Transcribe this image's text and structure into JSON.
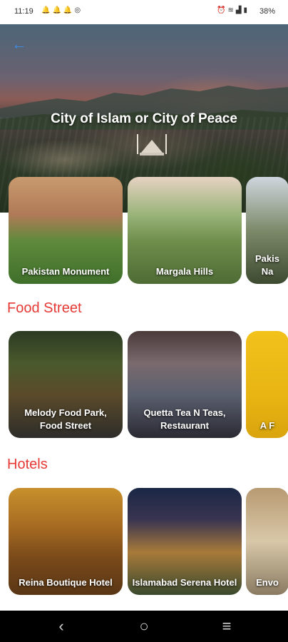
{
  "status_bar": {
    "time": "11:19",
    "left_icons": [
      "notification-bell-icon",
      "notification-bell-icon",
      "notification-bell-icon",
      "instagram-icon"
    ],
    "right_icons": [
      "alarm-icon",
      "wifi-icon",
      "signal-icon",
      "battery-icon"
    ],
    "battery": "38%"
  },
  "hero": {
    "title": "City of Islam or City of Peace",
    "back_icon": "back-arrow-icon"
  },
  "attractions": {
    "items": [
      {
        "label": "Pakistan Monument"
      },
      {
        "label": "Margala Hills"
      },
      {
        "label": "Pakis Na"
      }
    ]
  },
  "food_street": {
    "title": "Food Street",
    "items": [
      {
        "label": "Melody Food Park, Food Street"
      },
      {
        "label": "Quetta Tea N Teas, Restaurant"
      },
      {
        "label": "A F"
      }
    ]
  },
  "hotels": {
    "title": "Hotels",
    "items": [
      {
        "label": "Reina Boutique Hotel"
      },
      {
        "label": "Islamabad Serena Hotel"
      },
      {
        "label": "Envo"
      }
    ]
  },
  "nav_bar": {
    "back_icon": "back-chevron-icon",
    "home_icon": "home-circle-icon",
    "recents_icon": "menu-lines-icon"
  },
  "colors": {
    "section_title": "#e53935",
    "back_arrow": "#3a8ee6"
  }
}
